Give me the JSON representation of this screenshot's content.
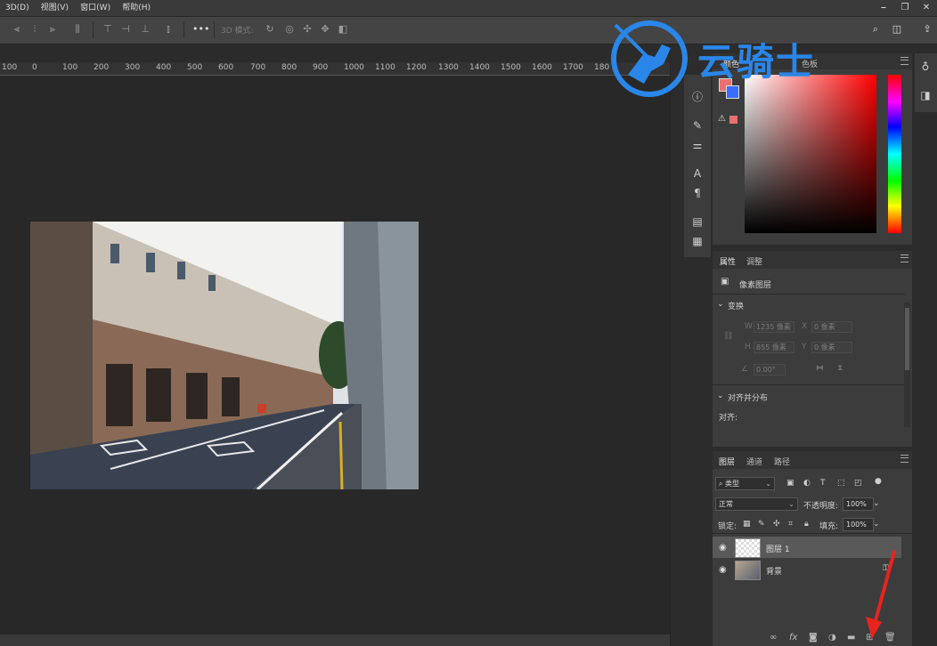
{
  "menubar": {
    "items": [
      "3D(D)",
      "视图(V)",
      "窗口(W)",
      "帮助(H)"
    ],
    "window_controls": [
      "⎯",
      "❐",
      "✕"
    ]
  },
  "optionsbar": {
    "more_label": "•••",
    "mode3d_label": "3D 模式:"
  },
  "ruler": {
    "ticks": [
      "100",
      "0",
      "100",
      "200",
      "300",
      "400",
      "500",
      "600",
      "700",
      "800",
      "900",
      "1000",
      "1100",
      "1200",
      "1300",
      "1400",
      "1500",
      "1600",
      "1700",
      "180"
    ]
  },
  "watermark": {
    "text": "云骑士"
  },
  "color_panel": {
    "tabs": [
      "颜色",
      "色板"
    ],
    "foreground": "#e97070",
    "background": "#3a6dff"
  },
  "properties": {
    "tabs": [
      "属性",
      "调整"
    ],
    "layer_type": "像素图层",
    "transform_title": "变换",
    "w_label": "W",
    "w_value": "1235 像素",
    "x_label": "X",
    "x_value": "0 像素",
    "h_label": "H",
    "h_value": "855 像素",
    "y_label": "Y",
    "y_value": "0 像素",
    "angle_value": "0.00°",
    "align_title": "对齐并分布",
    "align_label": "对齐:"
  },
  "layers": {
    "tabs": [
      "图层",
      "通道",
      "路径"
    ],
    "filter_kind": "类型",
    "blend_mode": "正常",
    "opacity_label": "不透明度:",
    "opacity_value": "100%",
    "lock_label": "锁定:",
    "fill_label": "填充:",
    "fill_value": "100%",
    "items": [
      {
        "name": "图层 1",
        "selected": true
      },
      {
        "name": "背景",
        "locked": true
      }
    ],
    "footer_icons": [
      "link-icon",
      "fx-icon",
      "mask-icon",
      "adjustment-icon",
      "folder-icon",
      "new-layer-icon",
      "trash-icon"
    ],
    "fx_label": "fx"
  }
}
